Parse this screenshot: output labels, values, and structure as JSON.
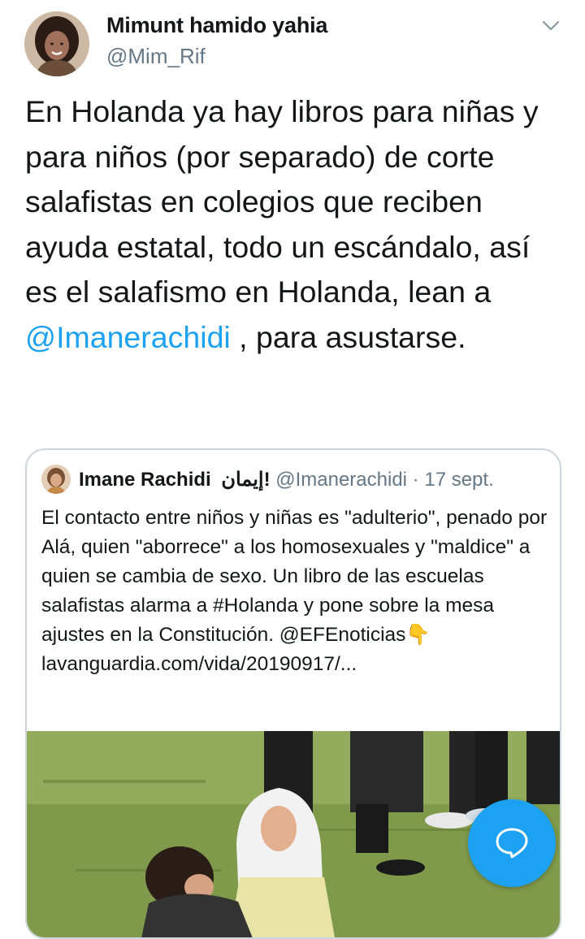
{
  "author": {
    "name": "Mimunt hamido yahia",
    "handle": "@Mim_Rif",
    "avatar_icon": "user-avatar"
  },
  "tweet": {
    "text_before_mention": "En Holanda ya hay libros para niñas y para niños (por separado) de corte salafistas en colegios que reciben ayuda estatal, todo un escándalo, así es el salafismo en Holanda, lean a ",
    "mention": "@Imanerachidi",
    "text_after_mention": " , para asustarse."
  },
  "quoted_tweet": {
    "name": "Imane Rachidi",
    "name_arabic": "إيمان",
    "name_arabic_mark": "!",
    "handle": "@Imanerachidi",
    "separator": "·",
    "date": "17 sept.",
    "text": "El contacto entre niños y niñas es \"adulterio\", penado por Alá, quien \"aborrece\" a los homosexuales y \"maldice\" a quien se cambia de sexo. Un libro de las escuelas salafistas alarma a #Holanda y pone sobre la mesa ajustes en la Constitución. @EFEnoticias",
    "emoji": "👇",
    "link": "lavanguardia.com/vida/20190917/..."
  },
  "icons": {
    "menu": "chevron-down-icon",
    "compose": "reply-bubble-icon"
  },
  "colors": {
    "accent": "#1da1f2",
    "text": "#14171a",
    "secondary": "#657786",
    "border": "#ccd6dd"
  }
}
